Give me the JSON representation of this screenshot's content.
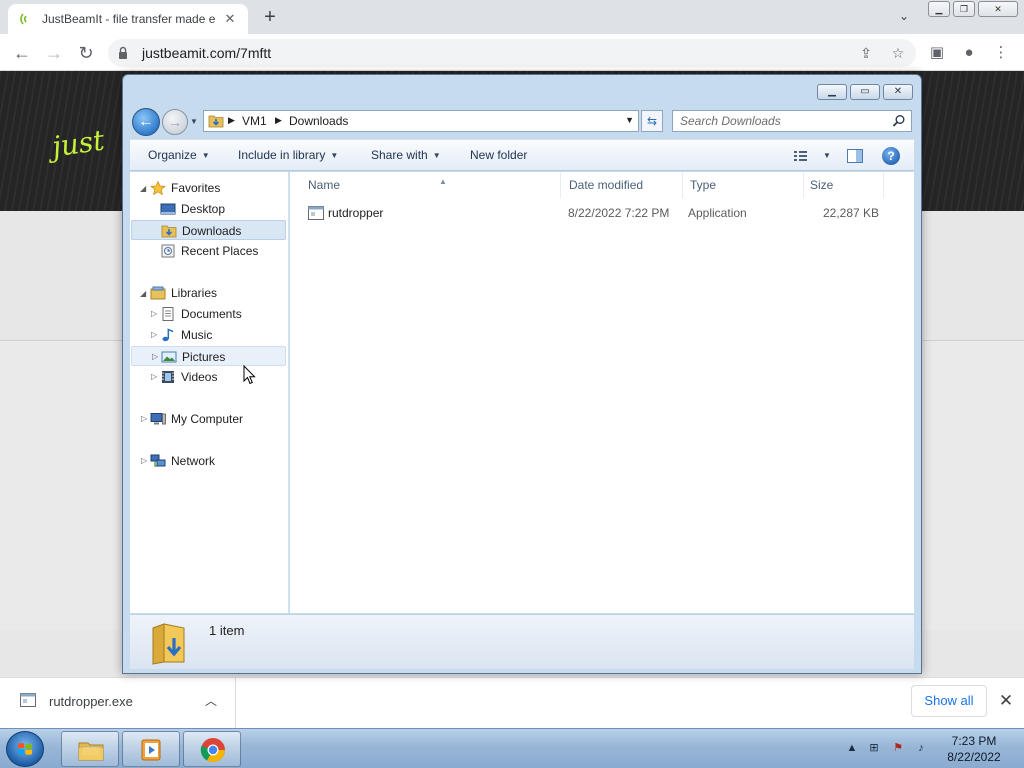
{
  "browser": {
    "tab_title": "JustBeamIt - file transfer made e",
    "url": "justbeamit.com/7mftt",
    "page_logo_text": "just"
  },
  "download_bar": {
    "filename": "rutdropper.exe",
    "show_all_label": "Show all"
  },
  "explorer": {
    "breadcrumb": [
      "VM1",
      "Downloads"
    ],
    "search_placeholder": "Search Downloads",
    "commands": {
      "organize": "Organize",
      "include_in_library": "Include in library",
      "share_with": "Share with",
      "new_folder": "New folder"
    },
    "nav": {
      "favorites": "Favorites",
      "desktop": "Desktop",
      "downloads": "Downloads",
      "recent_places": "Recent Places",
      "libraries": "Libraries",
      "documents": "Documents",
      "music": "Music",
      "pictures": "Pictures",
      "videos": "Videos",
      "my_computer": "My Computer",
      "network": "Network"
    },
    "columns": {
      "name": "Name",
      "date_modified": "Date modified",
      "type": "Type",
      "size": "Size"
    },
    "files": [
      {
        "name": "rutdropper",
        "date_modified": "8/22/2022 7:22 PM",
        "type": "Application",
        "size": "22,287 KB"
      }
    ],
    "status": "1 item"
  },
  "taskbar": {
    "time": "7:23 PM",
    "date": "8/22/2022"
  },
  "colors": {
    "chrome_tabbar": "#dee1e6",
    "win7_taskbar": "#98b6d7",
    "explorer_frame": "#c7dbef",
    "selected_nav": "#d9e6f4",
    "logo_green": "#c7f23a"
  }
}
